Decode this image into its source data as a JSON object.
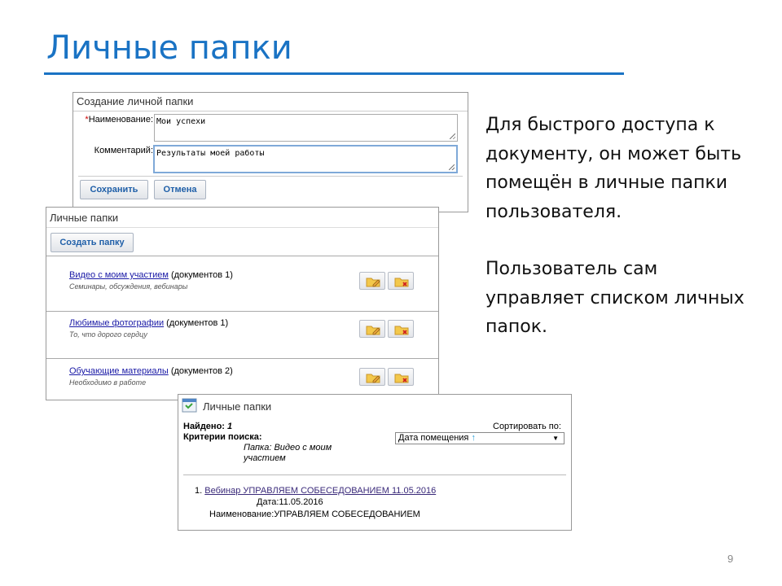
{
  "slide": {
    "title": "Личные папки",
    "paragraph1": "Для быстрого доступа к документу, он может быть помещён в личные папки пользователя.",
    "paragraph2": "Пользователь сам управляет списком личных папок.",
    "page_number": "9",
    "accent_color": "#1a73c4"
  },
  "create_panel": {
    "title": "Создание личной папки",
    "name_label": "Наименование:",
    "required_mark": "*",
    "name_value": "Мои успехи",
    "comment_label": "Комментарий:",
    "comment_value": "Результаты моей работы",
    "save_label": "Сохранить",
    "cancel_label": "Отмена"
  },
  "folders_panel": {
    "title": "Личные папки",
    "create_button": "Создать папку",
    "items": [
      {
        "name": "Видео с моим участием",
        "count": " (документов 1)",
        "desc": "Семинары, обсуждения, вебинары",
        "edit_icon": "folder-edit-icon",
        "delete_icon": "folder-delete-icon"
      },
      {
        "name": "Любимые фотографии",
        "count": " (документов 1)",
        "desc": "То, что дорого сердцу",
        "edit_icon": "folder-edit-icon",
        "delete_icon": "folder-delete-icon"
      },
      {
        "name": "Обучающие материалы",
        "count": " (документов 2)",
        "desc": "Необходимо в работе",
        "edit_icon": "folder-edit-icon",
        "delete_icon": "folder-delete-icon"
      }
    ]
  },
  "results_panel": {
    "title": "Личные папки",
    "found_label": "Найдено:",
    "found_value": "1",
    "criteria_label": "Критерии поиска:",
    "criteria_line1": "Папка: Видео с моим",
    "criteria_line2": "участием",
    "sort_label": "Сортировать по:",
    "sort_value": "Дата помещения",
    "sort_arrow": "↑",
    "result_number": "1.",
    "result_title": "Вебинар УПРАВЛЯЕМ СОБЕСЕДОВАНИЕМ 11.05.2016",
    "date_label": "Дата:",
    "date_value": "11.05.2016",
    "name_label": "Наименование:",
    "name_value": "УПРАВЛЯЕМ СОБЕСЕДОВАНИЕМ"
  }
}
